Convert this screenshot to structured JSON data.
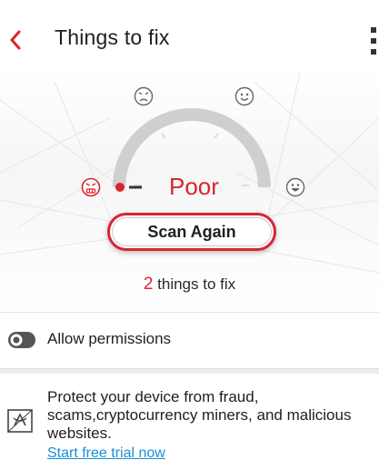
{
  "header": {
    "title": "Things to fix",
    "back_icon": "chevron-left-icon",
    "menu_icon": "more-vertical-icon"
  },
  "gauge": {
    "status": "Poor",
    "level": "poor",
    "faces": [
      "angry-face-icon",
      "sad-face-icon",
      "neutral-smile-face-icon",
      "happy-face-icon"
    ]
  },
  "scan_button": {
    "label": "Scan Again"
  },
  "summary": {
    "count": "2",
    "suffix": " things to fix"
  },
  "items": [
    {
      "label": "Allow permissions",
      "icon": "toggle-icon"
    },
    {
      "text": "Protect your device from fraud, scams,cryptocurrency miners, and malicious websites.",
      "link": "Start free trial now",
      "icon": "shield-icon"
    }
  ],
  "colors": {
    "accent": "#d9262e",
    "link": "#1a8fd6",
    "gauge_track": "#cfcfcf"
  }
}
